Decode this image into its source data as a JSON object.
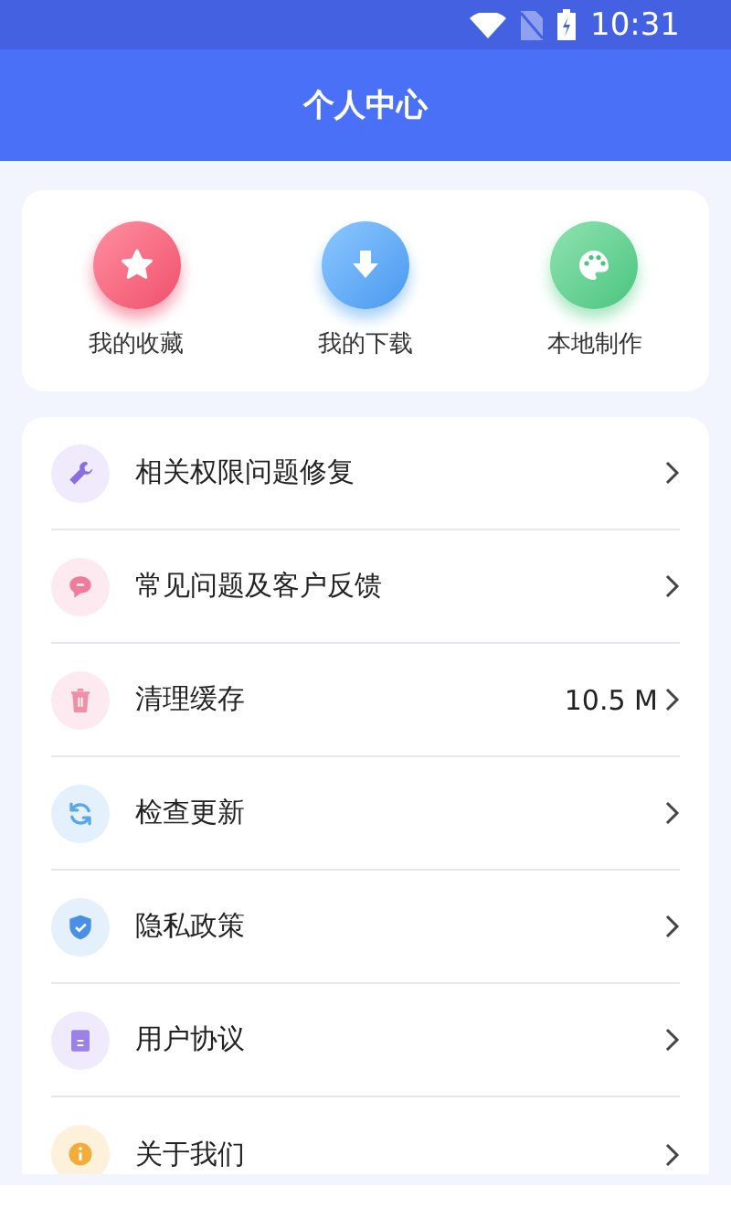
{
  "status_bar": {
    "time": "10:31"
  },
  "header": {
    "title": "个人中心"
  },
  "shortcuts": [
    {
      "label": "我的收藏",
      "kind": "star"
    },
    {
      "label": "我的下载",
      "kind": "download"
    },
    {
      "label": "本地制作",
      "kind": "palette"
    }
  ],
  "menu": [
    {
      "label": "相关权限问题修复",
      "kind": "wrench"
    },
    {
      "label": "常见问题及客户反馈",
      "kind": "chat"
    },
    {
      "label": "清理缓存",
      "kind": "trash",
      "value": "10.5 M"
    },
    {
      "label": "检查更新",
      "kind": "refresh"
    },
    {
      "label": "隐私政策",
      "kind": "shield"
    },
    {
      "label": "用户协议",
      "kind": "document"
    },
    {
      "label": "关于我们",
      "kind": "info"
    }
  ]
}
